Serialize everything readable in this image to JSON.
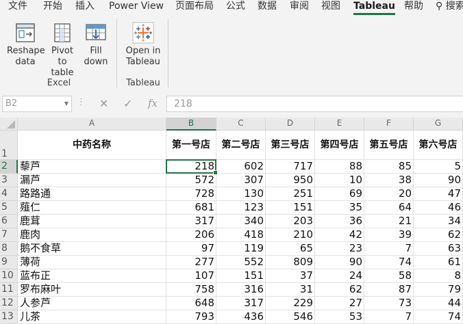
{
  "ribbon_tabs": [
    "文件",
    "开始",
    "插入",
    "Power View",
    "页面布局",
    "公式",
    "数据",
    "审阅",
    "视图",
    "Tableau",
    "帮助",
    "搜索"
  ],
  "active_tab": "Tableau",
  "groups": {
    "excel": {
      "label": "Excel",
      "buttons": [
        {
          "line1": "Reshape",
          "line2": "data",
          "icon": "reshape-data-icon"
        },
        {
          "line1": "Pivot",
          "line2": "to table",
          "icon": "pivot-to-table-icon"
        },
        {
          "line1": "Fill",
          "line2": "down",
          "icon": "fill-down-icon"
        }
      ]
    },
    "tableau": {
      "label": "Tableau",
      "buttons": [
        {
          "line1": "Open in",
          "line2": "Tableau",
          "icon": "tableau-logo-icon"
        }
      ]
    }
  },
  "formula_bar": {
    "name_box": "B2",
    "cancel_glyph": "✕",
    "enter_glyph": "✓",
    "fx": "fx",
    "value": "218"
  },
  "columns": [
    "A",
    "B",
    "C",
    "D",
    "E",
    "F",
    "G"
  ],
  "selected_cell": "B2",
  "header_row": [
    "中药名称",
    "第一号店",
    "第二号店",
    "第三号店",
    "第四号店",
    "第五号店",
    "第六号店"
  ],
  "rows": [
    {
      "n": "1"
    },
    {
      "n": "2",
      "cells": [
        "藜芦",
        "218",
        "602",
        "717",
        "88",
        "85",
        "5"
      ]
    },
    {
      "n": "3",
      "cells": [
        "漏芦",
        "572",
        "307",
        "950",
        "10",
        "38",
        "90"
      ]
    },
    {
      "n": "4",
      "cells": [
        "路路通",
        "728",
        "130",
        "251",
        "69",
        "20",
        "47"
      ]
    },
    {
      "n": "5",
      "cells": [
        "薤仁",
        "681",
        "123",
        "151",
        "35",
        "64",
        "46"
      ]
    },
    {
      "n": "6",
      "cells": [
        "鹿茸",
        "317",
        "340",
        "203",
        "36",
        "21",
        "34"
      ]
    },
    {
      "n": "7",
      "cells": [
        "鹿肉",
        "206",
        "418",
        "210",
        "42",
        "39",
        "62"
      ]
    },
    {
      "n": "8",
      "cells": [
        "鹅不食草",
        "97",
        "119",
        "65",
        "23",
        "7",
        "63"
      ]
    },
    {
      "n": "9",
      "cells": [
        "薄荷",
        "277",
        "552",
        "809",
        "90",
        "74",
        "61"
      ]
    },
    {
      "n": "10",
      "cells": [
        "蓝布正",
        "107",
        "151",
        "37",
        "24",
        "58",
        "8"
      ]
    },
    {
      "n": "11",
      "cells": [
        "罗布麻叶",
        "758",
        "316",
        "31",
        "62",
        "87",
        "79"
      ]
    },
    {
      "n": "12",
      "cells": [
        "人参芦",
        "648",
        "317",
        "229",
        "27",
        "73",
        "44"
      ]
    },
    {
      "n": "13",
      "cells": [
        "儿茶",
        "793",
        "436",
        "546",
        "53",
        "7",
        "74"
      ]
    }
  ]
}
